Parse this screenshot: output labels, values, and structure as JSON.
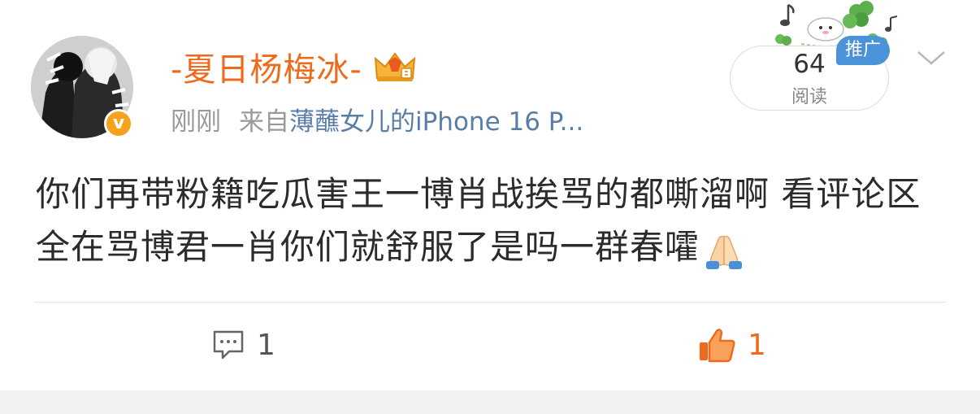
{
  "user": {
    "name": "-夏日杨梅冰-",
    "verified_mark": "v"
  },
  "post": {
    "time": "刚刚",
    "source_prefix": "来自",
    "source_device": "薄蘸女儿的iPhone 16 P...",
    "text": "你们再带粉籍吃瓜害王一博肖战挨骂的都嘶溜啊 看评论区全在骂博君一肖你们就舒服了是吗一群春嚯",
    "emoji": "folded-hands"
  },
  "reads": {
    "count": "64",
    "label": "阅读"
  },
  "promo": {
    "label": "推广"
  },
  "actions": {
    "comment_count": "1",
    "like_count": "1"
  },
  "colors": {
    "username": "#f06a1d",
    "source": "#5a7da8",
    "promo_tag": "#4b93d8",
    "like": "#f06a1d",
    "verified": "#f7a21b"
  },
  "icons": {
    "crown": "crown-badge-icon",
    "comment": "comment-icon",
    "like": "thumbs-up-icon",
    "menu": "chevron-down-icon"
  }
}
